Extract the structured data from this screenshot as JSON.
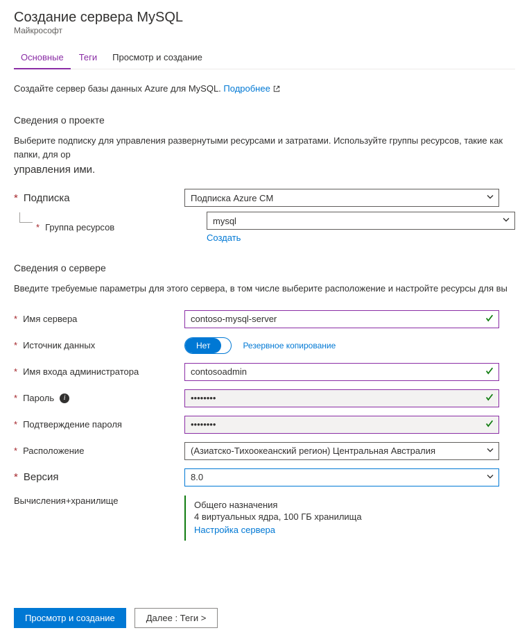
{
  "header": {
    "title": "Создание сервера MySQL",
    "publisher": "Майкрософт"
  },
  "tabs": {
    "basics": "Основные",
    "tags": "Теги",
    "review": "Просмотр и создание"
  },
  "intro": {
    "text": "Создайте сервер базы данных Azure для MySQL. ",
    "link": "Подробнее"
  },
  "project": {
    "heading": "Сведения о проекте",
    "help1": "Выберите подписку для управления развернутыми ресурсами и затратами. Используйте группы ресурсов, такие как папки, для ор",
    "help2": "управления ими.",
    "subscription_label": "Подписка",
    "subscription_value": "Подписка Azure CM",
    "rg_label": "Группа ресурсов",
    "rg_value": "mysql",
    "create_new": "Создать"
  },
  "server": {
    "heading": "Сведения о сервере",
    "help": "Введите требуемые параметры для этого сервера, в том числе выберите расположение и настройте ресурсы для вы",
    "name_label": "Имя сервера",
    "name_value": "contoso-mysql-server",
    "source_label": "Источник данных",
    "source_none": "Нет",
    "source_backup": "Резервное копирование",
    "admin_label": "Имя входа администратора",
    "admin_value": "contosoadmin",
    "pw_label": "Пароль",
    "pw_value": "••••••••",
    "pw2_label": "Подтверждение пароля",
    "pw2_value": "••••••••",
    "loc_label": "Расположение",
    "loc_value": "(Азиатско-Тихоокеанский регион) Центральная Австралия",
    "ver_label": "Версия",
    "ver_value": "8.0",
    "compute_label": "Вычисления+хранилище",
    "compute_tier": "Общего назначения",
    "compute_spec": "4 виртуальных ядра, 100 ГБ хранилища",
    "compute_link": "Настройка сервера"
  },
  "footer": {
    "review": "Просмотр и создание",
    "next": "Далее : Теги >"
  }
}
